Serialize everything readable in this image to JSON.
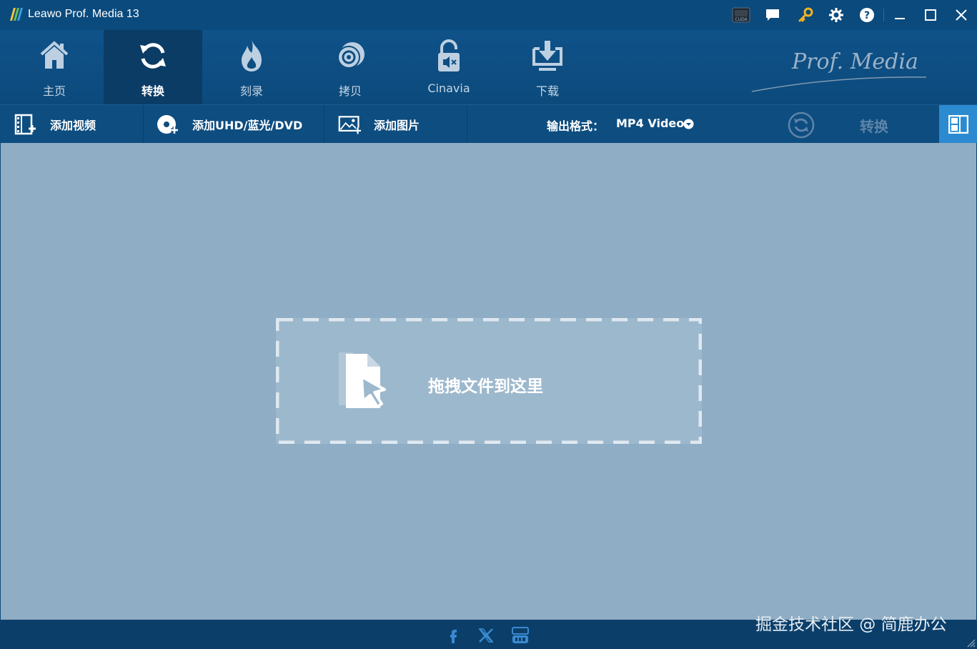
{
  "window": {
    "title": "Leawo Prof. Media 13",
    "icons": [
      "cuda-icon",
      "feedback-icon",
      "key-icon",
      "settings-icon",
      "help-icon",
      "minimize-icon",
      "maximize-icon",
      "close-icon"
    ]
  },
  "nav": {
    "items": [
      {
        "label": "主页",
        "icon": "home-icon"
      },
      {
        "label": "转换",
        "icon": "convert-icon",
        "active": true
      },
      {
        "label": "刻录",
        "icon": "burn-icon"
      },
      {
        "label": "拷贝",
        "icon": "copy-disc-icon"
      },
      {
        "label": "Cinavia",
        "icon": "cinavia-icon"
      },
      {
        "label": "下载",
        "icon": "download-icon"
      }
    ],
    "brand": "Prof. Media"
  },
  "toolbar": {
    "add_video": "添加视频",
    "add_disc": "添加UHD/蓝光/DVD",
    "add_photo": "添加图片",
    "output_format_label": "输出格式：",
    "output_format_value": "MP4 Video",
    "convert_label": "转换"
  },
  "content": {
    "drop_text": "拖拽文件到这里"
  },
  "footer": {
    "social": [
      "facebook-icon",
      "x-twitter-icon",
      "youtube-icon"
    ],
    "watermark": "掘金技术社区 @ 简鹿办公"
  },
  "colors": {
    "titlebar": "#0b4a7c",
    "content_bg": "#8fadc4",
    "dropzone_bg": "#9cb8cd",
    "accent": "#2b8ad0",
    "key_icon": "#f0b323"
  }
}
